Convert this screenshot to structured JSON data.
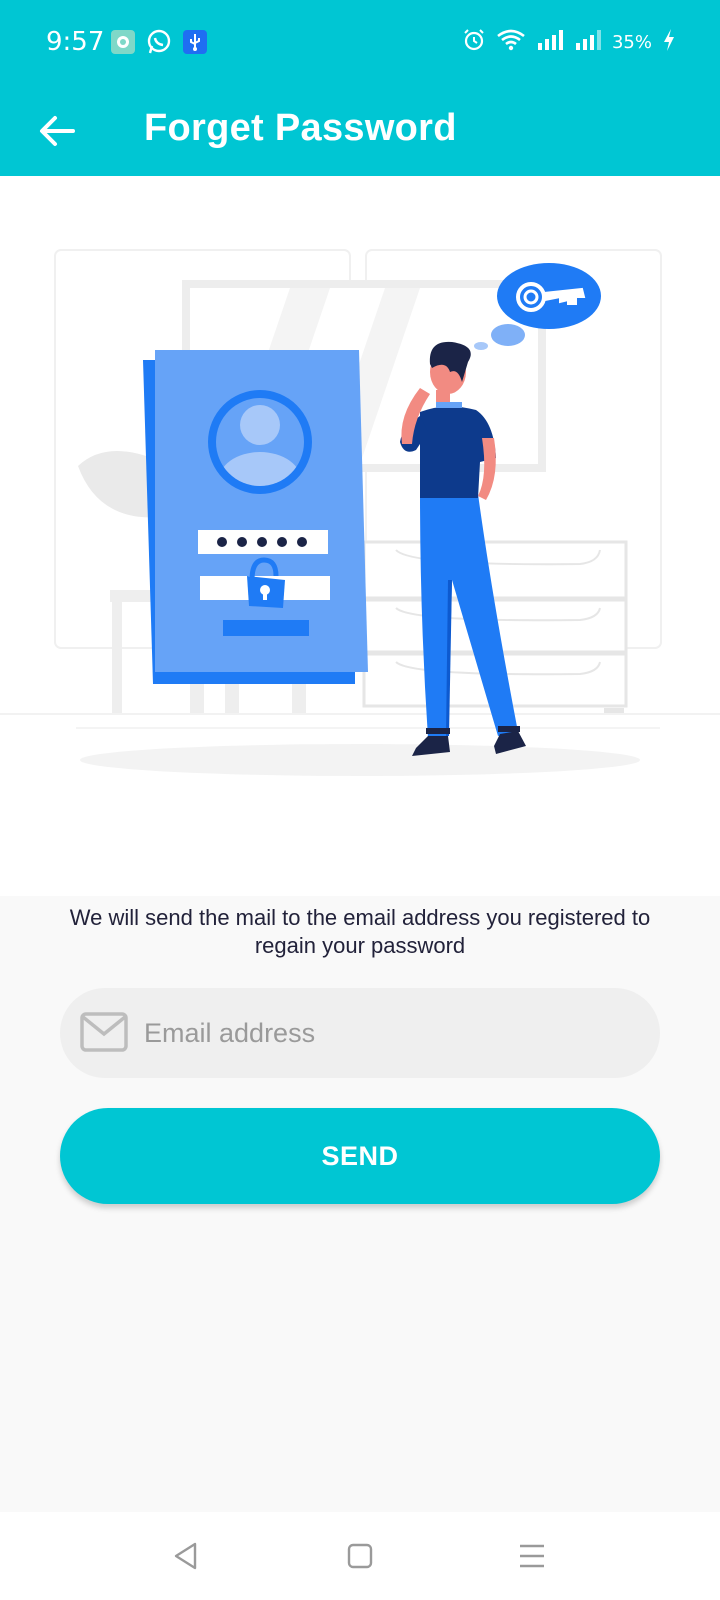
{
  "status_bar": {
    "time": "9:57",
    "battery": "35%",
    "left_icons": [
      "app-notification-icon",
      "whatsapp-icon",
      "usb-icon"
    ],
    "right_icons": [
      "alarm-icon",
      "wifi-icon",
      "signal-icon",
      "signal-icon",
      "battery-icon",
      "charging-icon"
    ]
  },
  "app_bar": {
    "title": "Forget Password",
    "back_icon": "arrow-left-icon"
  },
  "description": "We will send the mail to the email address you registered to regain your password",
  "email_field": {
    "placeholder": "Email address",
    "value": "",
    "icon": "mail-icon"
  },
  "send_button": {
    "label": "SEND"
  },
  "nav_bar": {
    "buttons": [
      "back-triangle-icon",
      "home-square-icon",
      "menu-lines-icon"
    ]
  },
  "colors": {
    "primary": "#00c6d3",
    "illustration_blue": "#1f7bf5",
    "illustration_light_blue": "#66a3f7",
    "illustration_navy": "#0d3a8c",
    "form_background": "#f9f9f9",
    "field_background": "#efefef"
  }
}
